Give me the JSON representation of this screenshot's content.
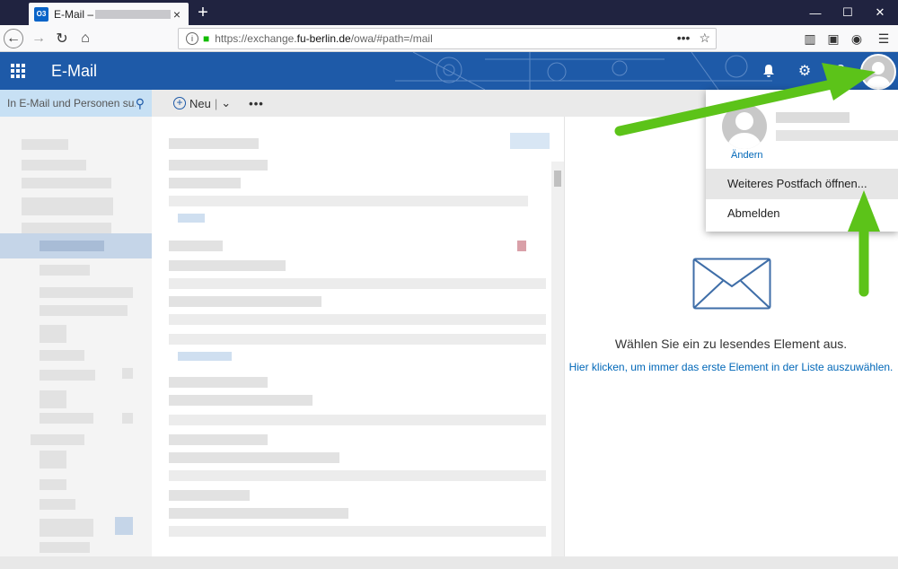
{
  "browser": {
    "tab_favicon": "O3",
    "tab_title": "E-Mail –",
    "tab_close": "×",
    "new_tab": "+",
    "url_prefix": "https://exchange.",
    "url_domain": "fu-berlin.de",
    "url_path": "/owa/#path=/mail",
    "url_more": "•••",
    "url_star": "☆",
    "minimize": "—",
    "maximize": "☐",
    "close": "✕"
  },
  "owa": {
    "app_title": "E-Mail",
    "search_placeholder": "In E-Mail und Personen su...",
    "new_label": "Neu",
    "more_label": "•••",
    "empty_title": "Wählen Sie ein zu lesendes Element aus.",
    "empty_link": "Hier klicken, um immer das erste Element in der Liste auszuwählen."
  },
  "account_menu": {
    "change_label": "Ändern",
    "items": [
      "Weiteres Postfach öffnen...",
      "Abmelden"
    ]
  },
  "colors": {
    "header": "#1e5aa8",
    "arrow": "#5cc319",
    "link": "#0067b8"
  },
  "icons": [
    "back-icon",
    "forward-icon",
    "reload-icon",
    "home-icon",
    "info-icon",
    "lock-icon",
    "library-icon",
    "sidebar-icon",
    "account-icon",
    "menu-icon",
    "waffle-icon",
    "bell-icon",
    "gear-icon",
    "help-icon",
    "search-icon",
    "plus-icon",
    "envelope-icon"
  ]
}
